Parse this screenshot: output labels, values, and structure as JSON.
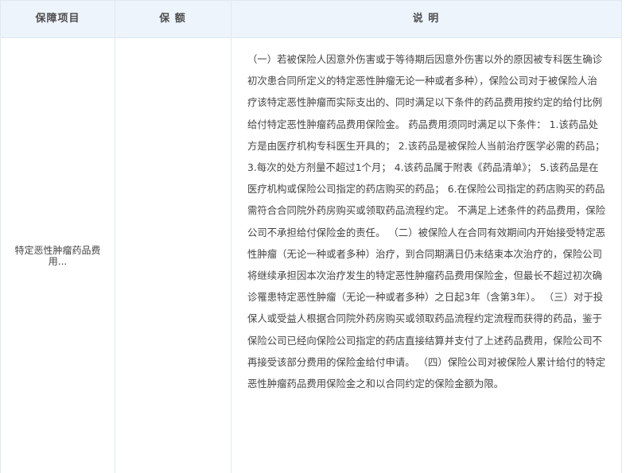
{
  "table": {
    "headers": {
      "item": "保障项目",
      "amount": "保 额",
      "description": "说 明"
    },
    "rows": [
      {
        "item": "特定恶性肿瘤药品费用...",
        "amount": "",
        "description": "（一）若被保险人因意外伤害或于等待期后因意外伤害以外的原因被专科医生确诊初次患合同所定义的特定恶性肿瘤无论一种或者多种），保险公司对于被保险人治疗该特定恶性肿瘤而实际支出的、同时满足以下条件的药品费用按约定的给付比例给付特定恶性肿瘤药品费用保险金。 药品费用须同时满足以下条件： 1.该药品处方是由医疗机构专科医生开具的； 2.该药品是被保险人当前治疗医学必需的药品； 3.每次的处方剂量不超过1个月； 4.该药品属于附表《药品清单》； 5.该药品是在医疗机构或保险公司指定的药店购买的药品； 6.在保险公司指定的药店购买的药品需符合合同院外药房购买或领取药品流程约定。 不满足上述条件的药品费用，保险公司不承担给付保险金的责任。 （二）被保险人在合同有效期间内开始接受特定恶性肿瘤（无论一种或者多种）治疗，到合同期满日仍未结束本次治疗的，保险公司将继续承担因本次治疗发生的特定恶性肿瘤药品费用保险金，但最长不超过初次确诊罹患特定恶性肿瘤（无论一种或者多种）之日起3年（含第3年）。 （三）对于投保人或受益人根据合同院外药房购买或领取药品流程约定流程而获得的药品，鉴于保险公司已经向保险公司指定的药店直接结算并支付了上述药品费用，保险公司不再接受该部分费用的保险金给付申请。 （四）保险公司对被保险人累计给付的特定恶性肿瘤药品费用保险金之和以合同约定的保险金额为限。"
      }
    ]
  }
}
